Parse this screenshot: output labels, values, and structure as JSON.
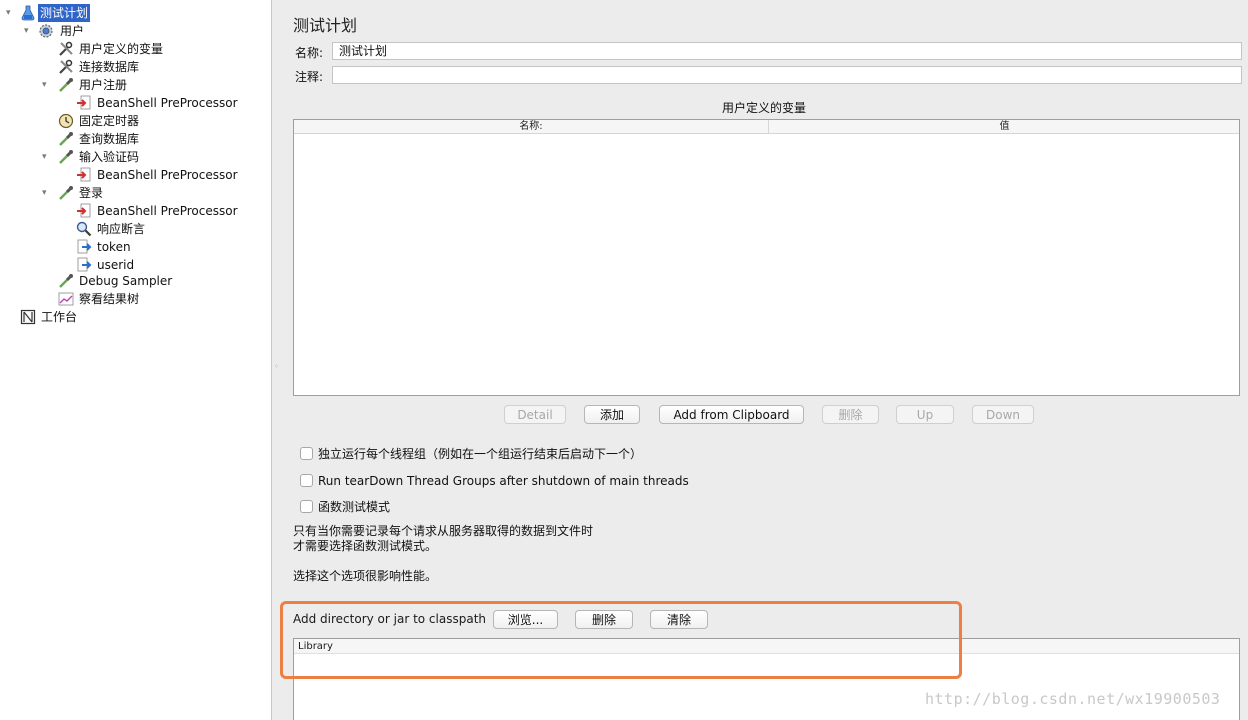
{
  "tree": {
    "items": [
      {
        "label": "测试计划",
        "icon": "flask-icon",
        "expanded": true,
        "selected": true
      },
      {
        "label": "用户",
        "icon": "gear-icon",
        "expanded": true
      },
      {
        "label": "用户定义的变量",
        "icon": "wrench-icon"
      },
      {
        "label": "连接数据库",
        "icon": "wrench-icon"
      },
      {
        "label": "用户注册",
        "icon": "pipette-icon",
        "expanded": true
      },
      {
        "label": "BeanShell PreProcessor",
        "icon": "preprocessor-icon"
      },
      {
        "label": "固定定时器",
        "icon": "timer-icon"
      },
      {
        "label": "查询数据库",
        "icon": "pipette-icon"
      },
      {
        "label": "输入验证码",
        "icon": "pipette-icon",
        "expanded": true
      },
      {
        "label": "BeanShell PreProcessor",
        "icon": "preprocessor-icon"
      },
      {
        "label": "登录",
        "icon": "pipette-icon",
        "expanded": true
      },
      {
        "label": "BeanShell PreProcessor",
        "icon": "preprocessor-icon"
      },
      {
        "label": "响应断言",
        "icon": "magnifier-icon"
      },
      {
        "label": "token",
        "icon": "extractor-icon"
      },
      {
        "label": "userid",
        "icon": "extractor-icon"
      },
      {
        "label": "Debug Sampler",
        "icon": "pipette-icon"
      },
      {
        "label": "察看结果树",
        "icon": "chart-icon"
      },
      {
        "label": "工作台",
        "icon": "workbench-icon"
      }
    ]
  },
  "panel": {
    "title": "测试计划",
    "name_label": "名称:",
    "name_value": "测试计划",
    "comment_label": "注释:",
    "comment_value": "",
    "vars_title": "用户定义的变量",
    "vars_columns": [
      "名称:",
      "值"
    ],
    "buttons": {
      "detail": "Detail",
      "add": "添加",
      "add_clipboard": "Add from Clipboard",
      "delete": "删除",
      "up": "Up",
      "down": "Down"
    },
    "checkboxes": [
      {
        "label": "独立运行每个线程组（例如在一个组运行结束后启动下一个）",
        "checked": false
      },
      {
        "label": "Run tearDown Thread Groups after shutdown of main threads",
        "checked": false
      },
      {
        "label": "函数测试模式",
        "checked": false
      }
    ],
    "note_lines": [
      "只有当你需要记录每个请求从服务器取得的数据到文件时",
      "才需要选择函数测试模式。",
      "选择这个选项很影响性能。"
    ],
    "classpath": {
      "label": "Add directory or jar to classpath",
      "browse": "浏览...",
      "delete": "删除",
      "clear": "清除",
      "table_header": "Library"
    },
    "highlight_color": "#ee7f43"
  },
  "watermark": "http://blog.csdn.net/wx19900503"
}
